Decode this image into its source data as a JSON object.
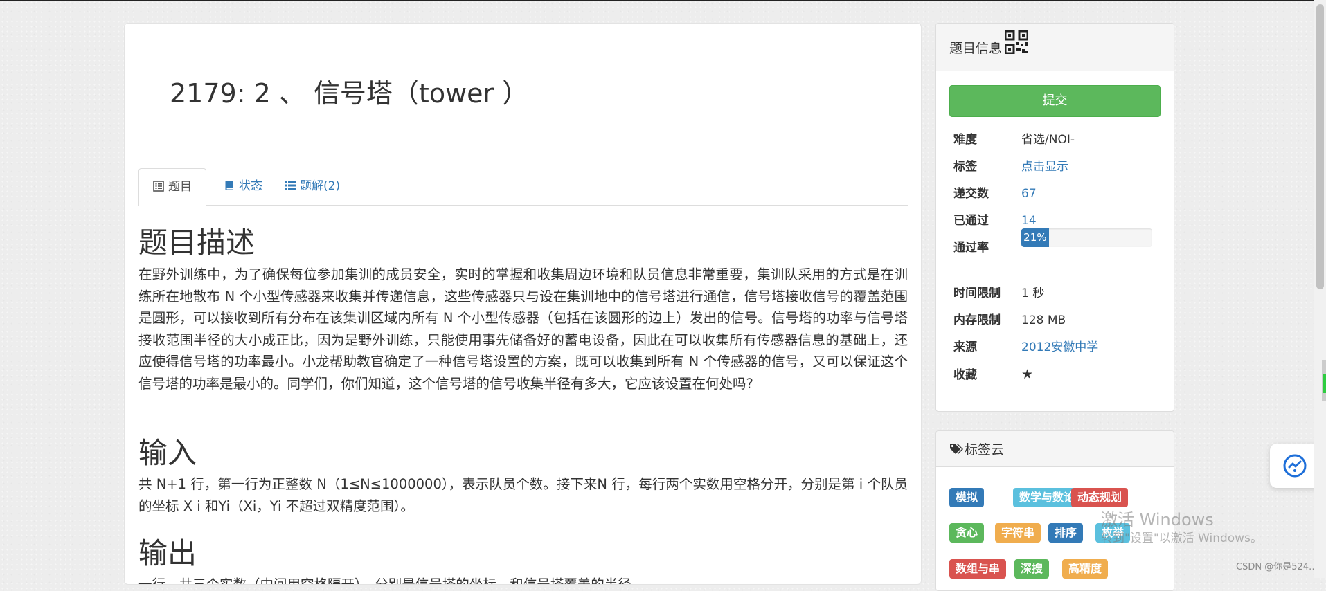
{
  "problem": {
    "title": "2179: 2 、 信号塔（tower ）",
    "tabs": [
      {
        "label": "题目",
        "icon": "list-alt-icon",
        "active": true
      },
      {
        "label": "状态",
        "icon": "book-icon",
        "active": false
      },
      {
        "label": "题解(2)",
        "icon": "list-icon",
        "active": false
      }
    ],
    "description_heading": "题目描述",
    "description": "  在野外训练中，为了确保每位参加集训的成员安全，实时的掌握和收集周边环境和队员信息非常重要，集训队采用的方式是在训练所在地散布 N 个小型传感器来收集并传递信息，这些传感器只与设在集训地中的信号塔进行通信，信号塔接收信号的覆盖范围是圆形，可以接收到所有分布在该集训区域内所有 N 个小型传感器（包括在该圆形的边上）发出的信号。信号塔的功率与信号塔接收范围半径的大小成正比，因为是野外训练，只能使用事先储备好的蓄电设备，因此在可以收集所有传感器信息的基础上，还应使得信号塔的功率最小。小龙帮助教官确定了一种信号塔设置的方案，既可以收集到所有 N 个传感器的信号，又可以保证这个信号塔的功率是最小的。同学们，你们知道，这个信号塔的信号收集半径有多大，它应该设置在何处吗?",
    "input_heading": "输入",
    "input": "共 N+1 行，第一行为正整数 N（1≤N≤1000000），表示队员个数。接下来N 行，每行两个实数用空格分开，分别是第 i 个队员的坐标 X i 和Yi（Xi，Yi 不超过双精度范围）。",
    "output_heading": "输出",
    "output": "一行，共三个实数（中间用空格隔开），分别是信号塔的坐标，和信号塔覆盖的半径。"
  },
  "sidebar": {
    "info_title": "题目信息",
    "info_icon": "qrcode-icon",
    "submit_label": "提交",
    "rows": {
      "difficulty": {
        "label": "难度",
        "value": "省选/NOI-"
      },
      "tags": {
        "label": "标签",
        "value": "点击显示"
      },
      "submissions": {
        "label": "递交数",
        "value": "67"
      },
      "accepted": {
        "label": "已通过",
        "value": "14"
      },
      "pass_rate": {
        "label": "通过率",
        "value": "21%",
        "fraction": 0.21
      },
      "time_limit": {
        "label": "时间限制",
        "value": "1 秒"
      },
      "memory_limit": {
        "label": "内存限制",
        "value": "128 MB"
      },
      "source": {
        "label": "来源",
        "value": "2012安徽中学"
      },
      "favorite": {
        "label": "收藏",
        "icon": "star-icon"
      }
    },
    "tag_cloud_title": "标签云",
    "tag_cloud_icon": "tags-icon",
    "tag_items": [
      {
        "label": "模拟",
        "color": "#337ab7"
      },
      {
        "label": "数学与数论",
        "color": "#5bc0de"
      },
      {
        "label": "动态规划",
        "color": "#d9534f"
      },
      {
        "label": "贪心",
        "color": "#5cb85c"
      },
      {
        "label": "字符串",
        "color": "#f0ad4e"
      },
      {
        "label": "排序",
        "color": "#337ab7"
      },
      {
        "label": "枚举",
        "color": "#5bc0de"
      },
      {
        "label": "数组与串",
        "color": "#d9534f"
      },
      {
        "label": "深搜",
        "color": "#5cb85c"
      },
      {
        "label": "高精度",
        "color": "#f0ad4e"
      }
    ]
  },
  "overlay": {
    "activate_title": "激活 Windows",
    "activate_sub": "转到\"设置\"以激活 Windows。",
    "csdn": "CSDN @你是524…"
  }
}
